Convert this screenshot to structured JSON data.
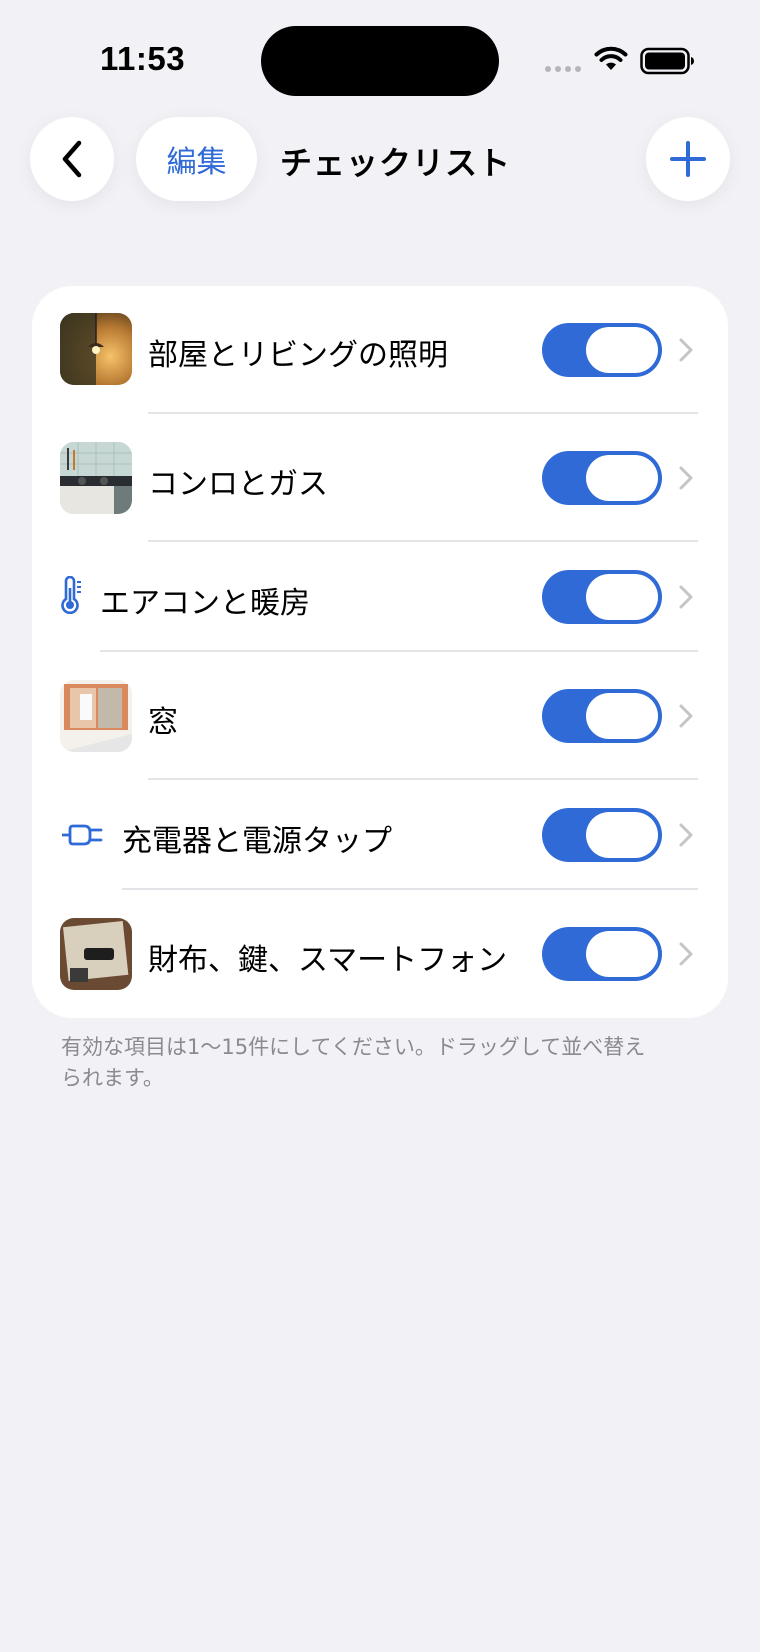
{
  "status_bar": {
    "time": "11:53"
  },
  "nav": {
    "edit_label": "編集",
    "title": "チェックリスト"
  },
  "items": [
    {
      "label": "部屋とリビングの照明",
      "icon": "ceiling-lamp-photo",
      "enabled": true
    },
    {
      "label": "コンロとガス",
      "icon": "kitchen-stove-photo",
      "enabled": true
    },
    {
      "label": "エアコンと暖房",
      "icon": "thermometer-icon",
      "enabled": true
    },
    {
      "label": "窓",
      "icon": "window-photo",
      "enabled": true
    },
    {
      "label": "充電器と電源タップ",
      "icon": "power-plug-icon",
      "enabled": true
    },
    {
      "label": "財布、鍵、スマートフォン",
      "icon": "wallet-keys-photo",
      "enabled": true
    }
  ],
  "footer": {
    "note": "有効な項目は1〜15件にしてください。ドラッグして並べ替えられます。"
  },
  "colors": {
    "accent": "#2f6ad6",
    "background": "#f1f1f6",
    "card": "#ffffff"
  }
}
